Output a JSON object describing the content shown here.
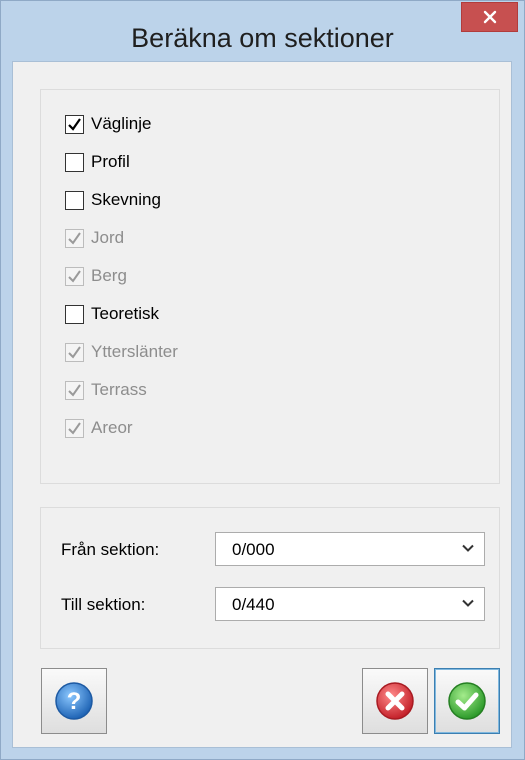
{
  "window": {
    "title": "Beräkna om sektioner"
  },
  "options": [
    {
      "label": "Väglinje",
      "checked": true,
      "enabled": true
    },
    {
      "label": "Profil",
      "checked": false,
      "enabled": true
    },
    {
      "label": "Skevning",
      "checked": false,
      "enabled": true
    },
    {
      "label": "Jord",
      "checked": true,
      "enabled": false
    },
    {
      "label": "Berg",
      "checked": true,
      "enabled": false
    },
    {
      "label": "Teoretisk",
      "checked": false,
      "enabled": true
    },
    {
      "label": "Ytterslänter",
      "checked": true,
      "enabled": false
    },
    {
      "label": "Terrass",
      "checked": true,
      "enabled": false
    },
    {
      "label": "Areor",
      "checked": true,
      "enabled": false
    }
  ],
  "sections": {
    "from_label": "Från sektion:",
    "from_value": "0/000",
    "to_label": "Till sektion:",
    "to_value": "0/440"
  },
  "buttons": {
    "help_icon": "help-icon",
    "cancel_icon": "cancel-icon",
    "ok_icon": "ok-icon"
  },
  "colors": {
    "titlebar": "#bcd3ea",
    "close": "#c75050",
    "help": "#2f7fcf",
    "cancel": "#d9363e",
    "ok": "#3fae3a"
  }
}
